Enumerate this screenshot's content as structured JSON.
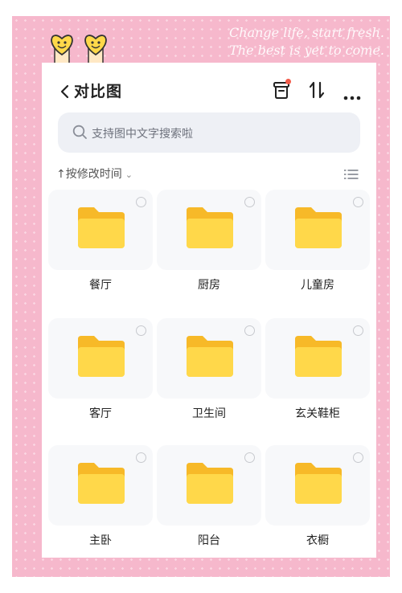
{
  "decor": {
    "tagline_line1": "Change life, start fresh.",
    "tagline_line2": "The best is yet to come."
  },
  "header": {
    "back_icon": "chevron-left-icon",
    "title": "对比图",
    "actions": [
      "box-icon",
      "sort-arrows-icon",
      "more-icon"
    ],
    "badge_color": "#f25b4a"
  },
  "search": {
    "placeholder": "支持图中文字搜索啦"
  },
  "sort": {
    "arrow": "↑",
    "label": "按修改时间",
    "view_icon": "list-view-icon"
  },
  "folders": [
    {
      "name": "餐厅"
    },
    {
      "name": "厨房"
    },
    {
      "name": "儿童房"
    },
    {
      "name": "客厅"
    },
    {
      "name": "卫生间"
    },
    {
      "name": "玄关鞋柜"
    },
    {
      "name": "主卧"
    },
    {
      "name": "阳台"
    },
    {
      "name": "衣橱"
    }
  ],
  "colors": {
    "frame_pink": "#f6b8cc",
    "folder_yellow": "#ffd84a",
    "folder_back": "#f7b928"
  }
}
